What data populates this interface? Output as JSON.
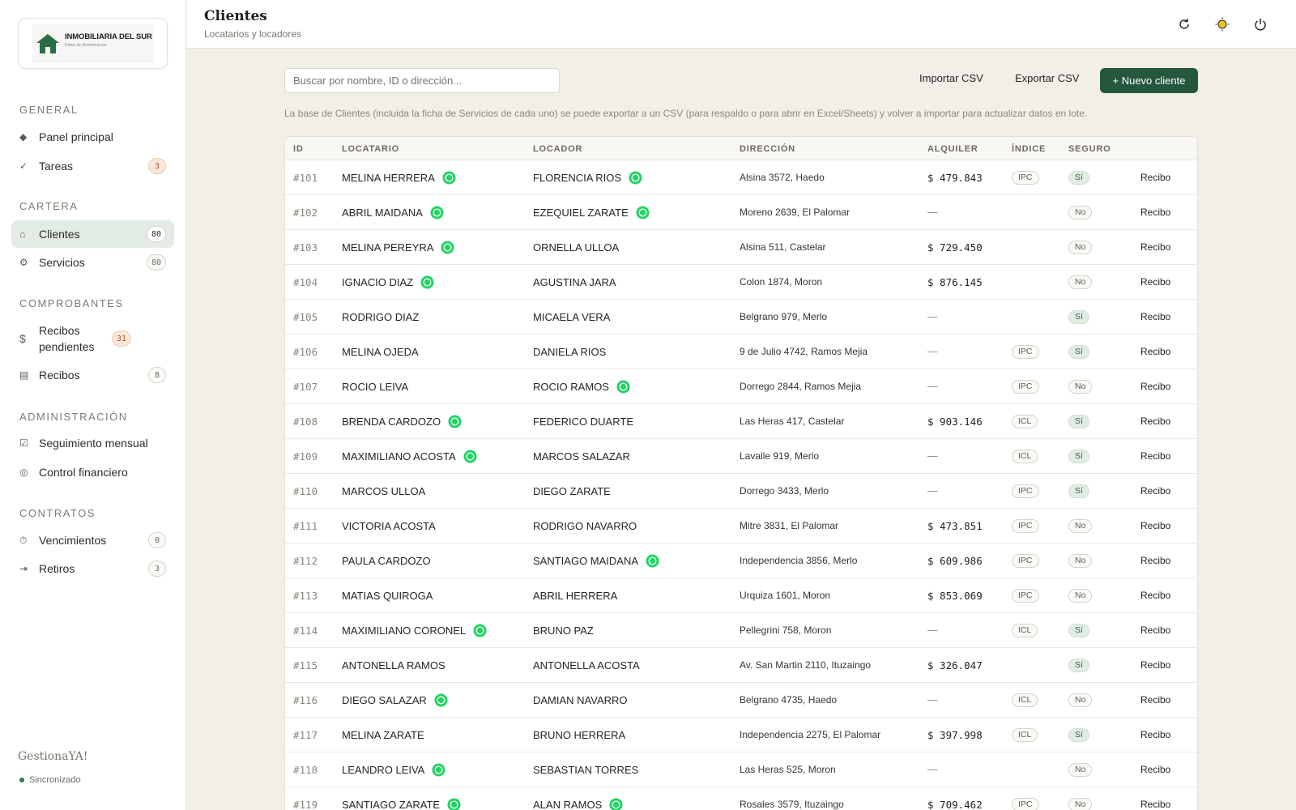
{
  "brand": {
    "logo_title": "INMOBILIARIA DEL SUR",
    "logo_subtitle": "Datos de demostración",
    "app_name": "GestionaYA!",
    "sync_status": "Sincronizado"
  },
  "sidebar": {
    "sections": [
      {
        "title": "GENERAL",
        "items": [
          {
            "label": "Panel principal",
            "icon": "diamond-icon",
            "badge": null
          },
          {
            "label": "Tareas",
            "icon": "check-icon",
            "badge": "3",
            "badge_style": "warn"
          }
        ]
      },
      {
        "title": "CARTERA",
        "items": [
          {
            "label": "Clientes",
            "icon": "home-icon",
            "badge": "80",
            "badge_style": "dark",
            "active": true
          },
          {
            "label": "Servicios",
            "icon": "gear-icon",
            "badge": "80"
          }
        ]
      },
      {
        "title": "COMPROBANTES",
        "items": [
          {
            "label": "Recibos pendientes",
            "icon": "dollar-icon",
            "badge": "31",
            "badge_style": "warn"
          },
          {
            "label": "Recibos",
            "icon": "list-icon",
            "badge": "8"
          }
        ]
      },
      {
        "title": "ADMINISTRACIÓN",
        "items": [
          {
            "label": "Seguimiento mensual",
            "icon": "checkbox-icon",
            "badge": null
          },
          {
            "label": "Control financiero",
            "icon": "circle-icon",
            "badge": null
          }
        ]
      },
      {
        "title": "CONTRATOS",
        "items": [
          {
            "label": "Vencimientos",
            "icon": "clock-icon",
            "badge": "0"
          },
          {
            "label": "Retiros",
            "icon": "exit-icon",
            "badge": "3"
          }
        ]
      }
    ]
  },
  "header": {
    "title": "Clientes",
    "subtitle": "Locatarios y locadores"
  },
  "toolbar": {
    "search_placeholder": "Buscar por nombre, ID o dirección...",
    "import_label": "Importar CSV",
    "export_label": "Exportar CSV",
    "new_label": "+ Nuevo cliente",
    "info": "La base de Clientes (incluida la ficha de Servicios de cada uno) se puede exportar a un CSV (para respaldo o para abrir en Excel/Sheets) y volver a importar para actualizar datos en lote."
  },
  "table": {
    "columns": [
      "ID",
      "LOCATARIO",
      "LOCADOR",
      "DIRECCIÓN",
      "ALQUILER",
      "ÍNDICE",
      "SEGURO"
    ],
    "rows": [
      {
        "id": "#101",
        "locatario": "MELINA HERRERA",
        "loc_wa": true,
        "locador": "FLORENCIA RIOS",
        "lcd_wa": true,
        "direccion": "Alsina 3572, Haedo",
        "alquiler": "$ 479.843",
        "indice": "IPC",
        "seguro": "Sí",
        "recibo": "Recibo"
      },
      {
        "id": "#102",
        "locatario": "ABRIL MAIDANA",
        "loc_wa": true,
        "locador": "EZEQUIEL ZARATE",
        "lcd_wa": true,
        "direccion": "Moreno 2639, El Palomar",
        "alquiler": "—",
        "indice": "",
        "seguro": "No",
        "recibo": "Recibo"
      },
      {
        "id": "#103",
        "locatario": "MELINA PEREYRA",
        "loc_wa": true,
        "locador": "ORNELLA ULLOA",
        "lcd_wa": false,
        "direccion": "Alsina 511, Castelar",
        "alquiler": "$ 729.450",
        "indice": "",
        "seguro": "No",
        "recibo": "Recibo"
      },
      {
        "id": "#104",
        "locatario": "IGNACIO DIAZ",
        "loc_wa": true,
        "locador": "AGUSTINA JARA",
        "lcd_wa": false,
        "direccion": "Colon 1874, Moron",
        "alquiler": "$ 876.145",
        "indice": "",
        "seguro": "No",
        "recibo": "Recibo"
      },
      {
        "id": "#105",
        "locatario": "RODRIGO DIAZ",
        "loc_wa": false,
        "locador": "MICAELA VERA",
        "lcd_wa": false,
        "direccion": "Belgrano 979, Merlo",
        "alquiler": "—",
        "indice": "",
        "seguro": "Sí",
        "recibo": "Recibo"
      },
      {
        "id": "#106",
        "locatario": "MELINA OJEDA",
        "loc_wa": false,
        "locador": "DANIELA RIOS",
        "lcd_wa": false,
        "direccion": "9 de Julio 4742, Ramos Mejia",
        "alquiler": "—",
        "indice": "IPC",
        "seguro": "Sí",
        "recibo": "Recibo"
      },
      {
        "id": "#107",
        "locatario": "ROCIO LEIVA",
        "loc_wa": false,
        "locador": "ROCIO RAMOS",
        "lcd_wa": true,
        "direccion": "Dorrego 2844, Ramos Mejia",
        "alquiler": "—",
        "indice": "IPC",
        "seguro": "No",
        "recibo": "Recibo"
      },
      {
        "id": "#108",
        "locatario": "BRENDA CARDOZO",
        "loc_wa": true,
        "locador": "FEDERICO DUARTE",
        "lcd_wa": false,
        "direccion": "Las Heras 417, Castelar",
        "alquiler": "$ 903.146",
        "indice": "ICL",
        "seguro": "Sí",
        "recibo": "Recibo"
      },
      {
        "id": "#109",
        "locatario": "MAXIMILIANO ACOSTA",
        "loc_wa": true,
        "locador": "MARCOS SALAZAR",
        "lcd_wa": false,
        "direccion": "Lavalle 919, Merlo",
        "alquiler": "—",
        "indice": "ICL",
        "seguro": "Sí",
        "recibo": "Recibo"
      },
      {
        "id": "#110",
        "locatario": "MARCOS ULLOA",
        "loc_wa": false,
        "locador": "DIEGO ZARATE",
        "lcd_wa": false,
        "direccion": "Dorrego 3433, Merlo",
        "alquiler": "—",
        "indice": "IPC",
        "seguro": "Sí",
        "recibo": "Recibo"
      },
      {
        "id": "#111",
        "locatario": "VICTORIA ACOSTA",
        "loc_wa": false,
        "locador": "RODRIGO NAVARRO",
        "lcd_wa": false,
        "direccion": "Mitre 3831, El Palomar",
        "alquiler": "$ 473.851",
        "indice": "IPC",
        "seguro": "No",
        "recibo": "Recibo"
      },
      {
        "id": "#112",
        "locatario": "PAULA CARDOZO",
        "loc_wa": false,
        "locador": "SANTIAGO MAIDANA",
        "lcd_wa": true,
        "direccion": "Independencia 3856, Merlo",
        "alquiler": "$ 609.986",
        "indice": "IPC",
        "seguro": "No",
        "recibo": "Recibo"
      },
      {
        "id": "#113",
        "locatario": "MATIAS QUIROGA",
        "loc_wa": false,
        "locador": "ABRIL HERRERA",
        "lcd_wa": false,
        "direccion": "Urquiza 1601, Moron",
        "alquiler": "$ 853.069",
        "indice": "IPC",
        "seguro": "No",
        "recibo": "Recibo"
      },
      {
        "id": "#114",
        "locatario": "MAXIMILIANO CORONEL",
        "loc_wa": true,
        "locador": "BRUNO PAZ",
        "lcd_wa": false,
        "direccion": "Pellegrini 758, Moron",
        "alquiler": "—",
        "indice": "ICL",
        "seguro": "Sí",
        "recibo": "Recibo"
      },
      {
        "id": "#115",
        "locatario": "ANTONELLA RAMOS",
        "loc_wa": false,
        "locador": "ANTONELLA ACOSTA",
        "lcd_wa": false,
        "direccion": "Av. San Martin 2110, Ituzaingo",
        "alquiler": "$ 326.047",
        "indice": "",
        "seguro": "Sí",
        "recibo": "Recibo"
      },
      {
        "id": "#116",
        "locatario": "DIEGO SALAZAR",
        "loc_wa": true,
        "locador": "DAMIAN NAVARRO",
        "lcd_wa": false,
        "direccion": "Belgrano 4735, Haedo",
        "alquiler": "—",
        "indice": "ICL",
        "seguro": "No",
        "recibo": "Recibo"
      },
      {
        "id": "#117",
        "locatario": "MELINA ZARATE",
        "loc_wa": false,
        "locador": "BRUNO HERRERA",
        "lcd_wa": false,
        "direccion": "Independencia 2275, El Palomar",
        "alquiler": "$ 397.998",
        "indice": "ICL",
        "seguro": "Sí",
        "recibo": "Recibo"
      },
      {
        "id": "#118",
        "locatario": "LEANDRO LEIVA",
        "loc_wa": true,
        "locador": "SEBASTIAN TORRES",
        "lcd_wa": false,
        "direccion": "Las Heras 525, Moron",
        "alquiler": "—",
        "indice": "",
        "seguro": "No",
        "recibo": "Recibo"
      },
      {
        "id": "#119",
        "locatario": "SANTIAGO ZARATE",
        "loc_wa": true,
        "locador": "ALAN RAMOS",
        "lcd_wa": true,
        "direccion": "Rosales 3579, Ituzaingo",
        "alquiler": "$ 709.462",
        "indice": "IPC",
        "seguro": "No",
        "recibo": "Recibo"
      }
    ]
  },
  "colors": {
    "accent": "#24573d",
    "whatsapp": "#25d366",
    "warn_badge": "#fbe7d9",
    "yes_pill": "#e1ece3"
  }
}
